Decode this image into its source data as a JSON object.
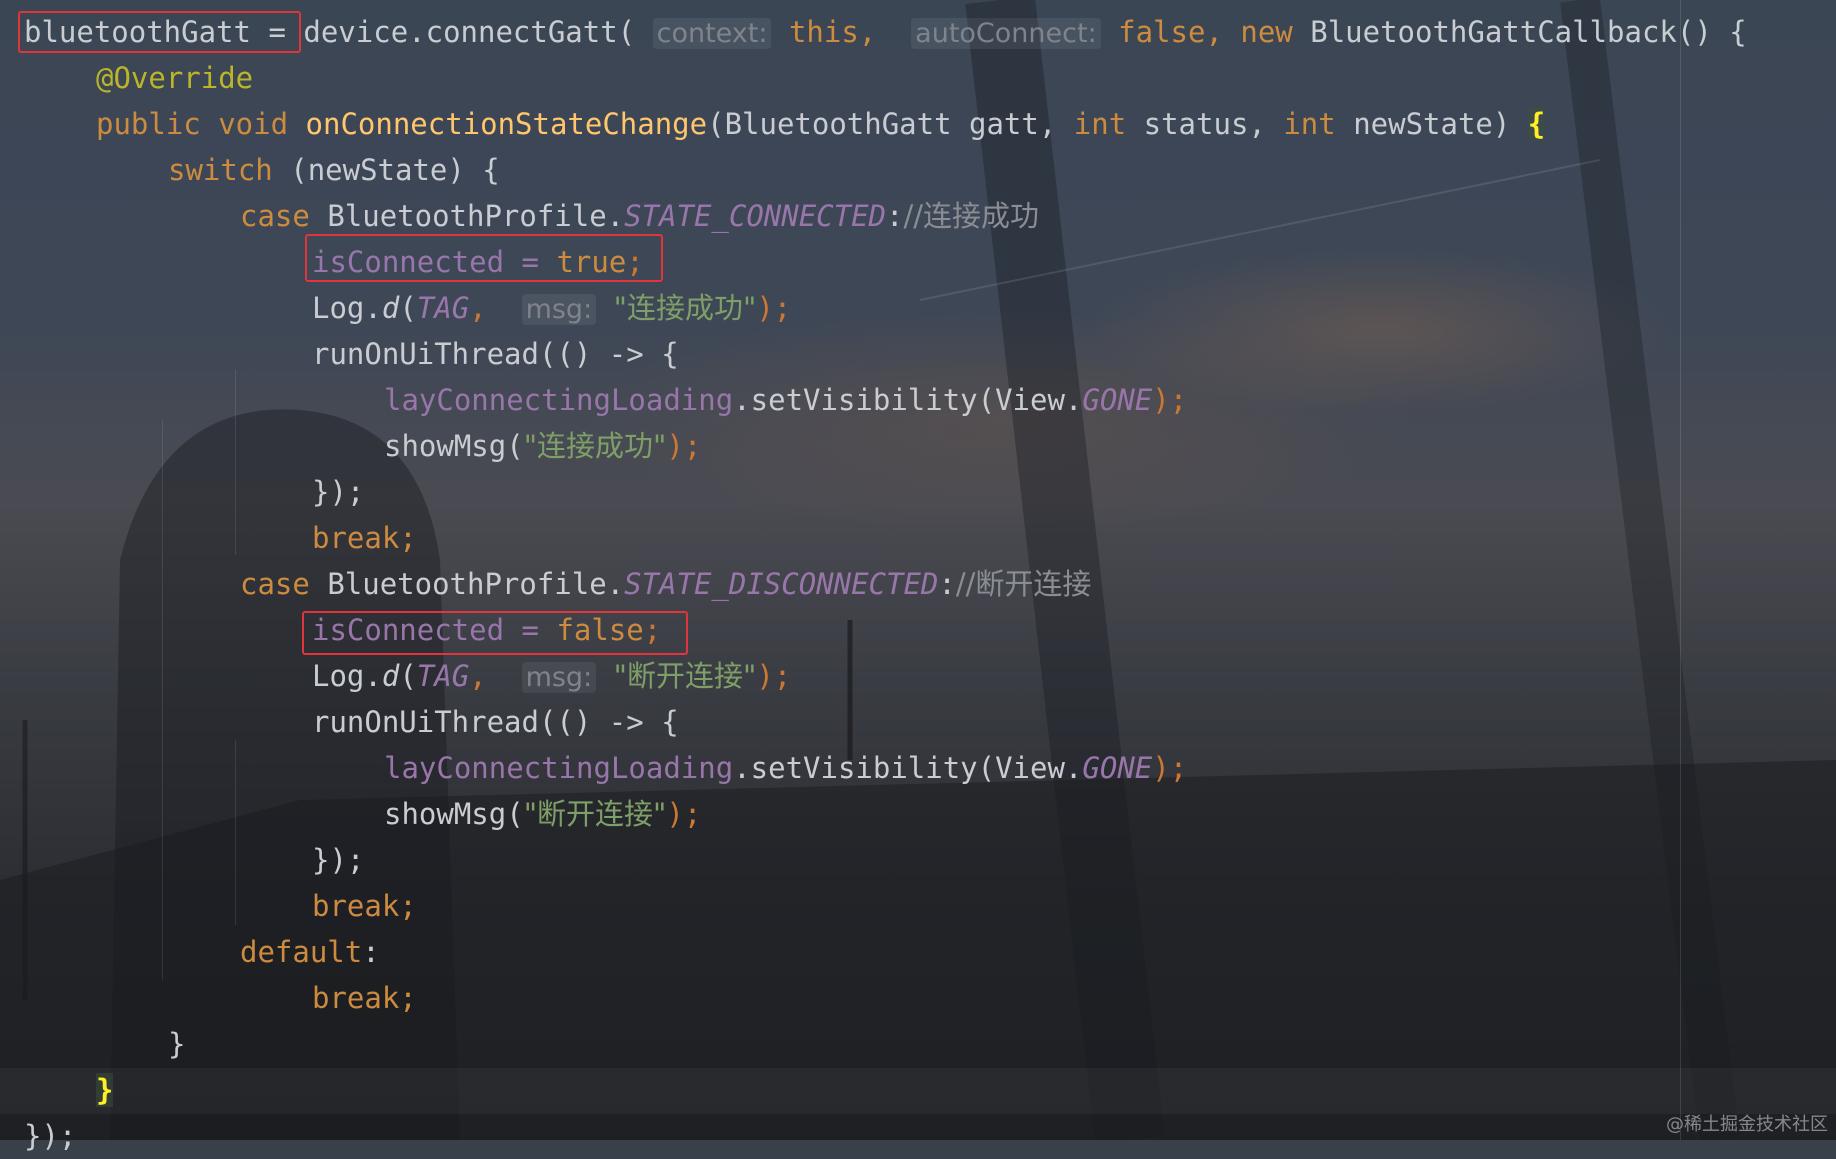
{
  "editor": {
    "theme_colors": {
      "keyword": "#cc8b3e",
      "method": "#ffc66d",
      "string": "#7f9f68",
      "comment": "#8a8d93",
      "constant": "#9876aa",
      "annotation": "#bbb529",
      "highlight_box": "#e0353b"
    },
    "code": {
      "l1": {
        "var": "bluetoothGatt",
        "op": "=",
        "call": "device.connectGatt(",
        "hint_context": "context:",
        "arg_this": "this,",
        "hint_autoconnect": "autoConnect:",
        "arg_false": "false,",
        "kw_new": "new",
        "callback": "BluetoothGattCallback() {"
      },
      "l2": {
        "annotation": "@Override"
      },
      "l3": {
        "kw": "public void",
        "method": "onConnectionStateChange",
        "params_a": "(BluetoothGatt gatt,",
        "type_int1": "int",
        "param_status": "status,",
        "type_int2": "int",
        "param_new": "newState)",
        "brace": "{"
      },
      "l4": {
        "kw": "switch",
        "rest": "(newState) {"
      },
      "l5": {
        "kw": "case",
        "cls": "BluetoothProfile.",
        "const": "STATE_CONNECTED",
        "colon": ":",
        "comment": "//连接成功"
      },
      "l6": {
        "text": "isConnected = ",
        "value": "true",
        "semi": ";"
      },
      "l7": {
        "log": "Log.",
        "d": "d",
        "open": "(",
        "tag": "TAG",
        "comma": ",",
        "hint_msg": "msg:",
        "str": "\"连接成功\"",
        "close": ");"
      },
      "l8": {
        "text": "runOnUiThread(() -> {"
      },
      "l9": {
        "field": "layConnectingLoading",
        "call": ".setVisibility(View.",
        "const": "GONE",
        "close": ");"
      },
      "l10": {
        "call": "showMsg(",
        "str": "\"连接成功\"",
        "close": ");"
      },
      "l11": {
        "text": "});"
      },
      "l12": {
        "kw": "break;"
      },
      "l13": {
        "kw": "case",
        "cls": "BluetoothProfile.",
        "const": "STATE_DISCONNECTED",
        "colon": ":",
        "comment": "//断开连接"
      },
      "l14": {
        "text": "isConnected = ",
        "value": "false",
        "semi": ";"
      },
      "l15": {
        "log": "Log.",
        "d": "d",
        "open": "(",
        "tag": "TAG",
        "comma": ",",
        "hint_msg": "msg:",
        "str": "\"断开连接\"",
        "close": ");"
      },
      "l16": {
        "text": "runOnUiThread(() -> {"
      },
      "l17": {
        "field": "layConnectingLoading",
        "call": ".setVisibility(View.",
        "const": "GONE",
        "close": ");"
      },
      "l18": {
        "call": "showMsg(",
        "str": "\"断开连接\"",
        "close": ");"
      },
      "l19": {
        "text": "});"
      },
      "l20": {
        "kw": "break;"
      },
      "l21": {
        "kw": "default",
        "colon": ":"
      },
      "l22": {
        "kw": "break;"
      },
      "l23": {
        "text": "}"
      },
      "l24": {
        "brace": "}"
      },
      "l25": {
        "text": "});"
      }
    }
  },
  "watermark": "@稀土掘金技术社区"
}
